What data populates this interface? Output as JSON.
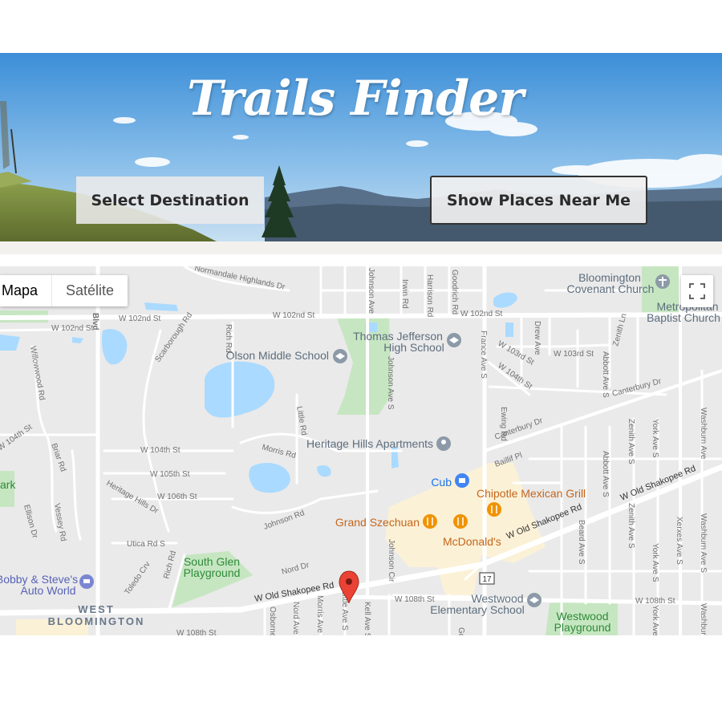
{
  "header": {
    "title": "Trails Finder",
    "select_button": "Select Destination",
    "near_button": "Show Places Near Me"
  },
  "map": {
    "type_control": {
      "map": "Mapa",
      "satellite": "Satélite"
    },
    "pois": {
      "bloomington_covenant_1": "Bloomington",
      "bloomington_covenant_2": "Covenant Church",
      "metropolitan_1": "Metropolitan",
      "metropolitan_2": "Baptist Church",
      "thomas_jefferson_1": "Thomas Jefferson",
      "thomas_jefferson_2": "High School",
      "olson": "Olson Middle School",
      "heritage_hills": "Heritage Hills Apartments",
      "cub": "Cub",
      "chipotle": "Chipotle Mexican Grill",
      "grand_szechuan": "Grand Szechuan",
      "mcdonalds": "McDonald's",
      "south_glen_1": "South Glen",
      "south_glen_2": "Playground",
      "bobby_1": "Bobby & Steve's",
      "bobby_2": "Auto World",
      "westwood_school_1": "Westwood",
      "westwood_school_2": "Elementary School",
      "westwood_pg_1": "Westwood",
      "westwood_pg_2": "Playground",
      "west_bloomington_1": "WEST",
      "west_bloomington_2": "BLOOMINGTON",
      "park_partial": "ark"
    },
    "streets": {
      "w102_a": "W 102nd St",
      "w102_b": "W 102nd St",
      "w102_c": "W 102nd St",
      "w103": "W 103rd St",
      "w103_b": "W 103rd St",
      "w104_a": "W 104th St",
      "w104_b": "W 104th St",
      "w104_c": "W 104th St",
      "w105": "W 105th St",
      "w106": "W 106th St",
      "w108_a": "W 108th St",
      "w108_b": "W 108th St",
      "w108_c": "W 108th St",
      "shakopee_a": "W Old Shakopee Rd",
      "shakopee_b": "W Old Shakopee Rd",
      "shakopee_c": "W Old Shakopee Rd",
      "normandale": "Normandale Highlands Dr",
      "france": "France Ave S",
      "johnson_ave": "Johnson Ave",
      "irwin": "Irwin Rd",
      "harrison": "Harrison Rd",
      "goodrich": "Goodrich Rd",
      "rich": "Rich Rd",
      "rich_b": "Rich Rd",
      "scarborough": "Scarborough Rd",
      "willow": "Willowwood Rd",
      "briar": "Briar Rd",
      "vessey": "Vessey Rd",
      "ellison": "Ellison Dr",
      "heritage_hills_dr": "Heritage Hills Dr",
      "morris": "Morris Rd",
      "morris_ave": "Morris Ave S",
      "little": "Little Rd",
      "little_ave": "Little Ave S",
      "johnson_rd": "Johnson Rd",
      "johnson_ave_s": "Johnson Ave S",
      "johnson_cir": "Johnson Cir",
      "utica": "Utica Rd S",
      "toledo": "Toledo Crv",
      "nord": "Nord Dr",
      "nord_ave": "Nord Ave S",
      "osborne": "Osborne",
      "kell": "Kell Ave S",
      "ewing": "Ewing Rd",
      "drew": "Drew Ave",
      "abbott_a": "Abbott Ave S",
      "abbott_b": "Abbott Ave S",
      "zenith_a": "Zenith Ln",
      "zenith_b": "Zenith Ave S",
      "zenith_c": "Zenith Ave S",
      "york_a": "York Ave S",
      "york_b": "York Ave S",
      "york_c": "York Ave S",
      "xerxes": "Xerxes Ave S",
      "washburn_a": "Washburn Ave",
      "washburn_b": "Washburn Ave S",
      "washburn_c": "Washburn Ave S",
      "beard": "Beard Ave S",
      "canterbury_a": "Canterbury Dr",
      "canterbury_b": "Canterbury Dr",
      "baillif": "Baillif Pl",
      "goodrich_s": "Goo",
      "blvd": "Blvd",
      "hwy": "17"
    }
  }
}
